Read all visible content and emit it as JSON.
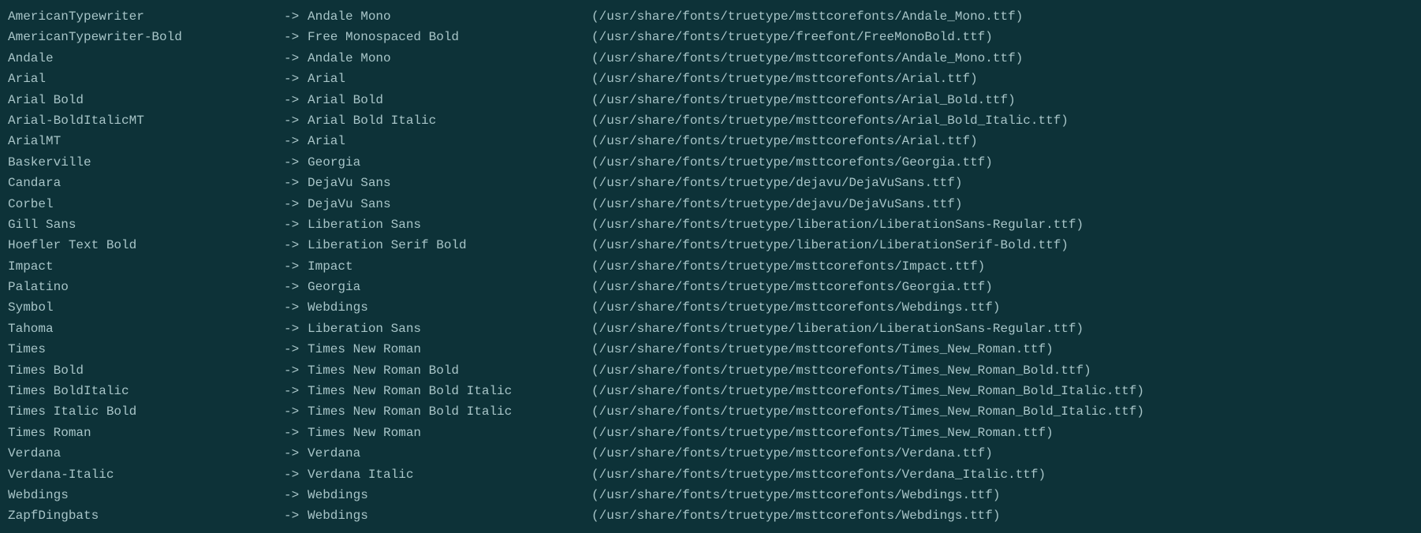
{
  "arrow": "->",
  "mappings": [
    {
      "source": "AmericanTypewriter",
      "target": "Andale Mono",
      "path": "(/usr/share/fonts/truetype/msttcorefonts/Andale_Mono.ttf)"
    },
    {
      "source": "AmericanTypewriter-Bold",
      "target": "Free Monospaced Bold",
      "path": "(/usr/share/fonts/truetype/freefont/FreeMonoBold.ttf)"
    },
    {
      "source": "Andale",
      "target": "Andale Mono",
      "path": "(/usr/share/fonts/truetype/msttcorefonts/Andale_Mono.ttf)"
    },
    {
      "source": "Arial",
      "target": "Arial",
      "path": "(/usr/share/fonts/truetype/msttcorefonts/Arial.ttf)"
    },
    {
      "source": "Arial Bold",
      "target": "Arial Bold",
      "path": "(/usr/share/fonts/truetype/msttcorefonts/Arial_Bold.ttf)"
    },
    {
      "source": "Arial-BoldItalicMT",
      "target": "Arial Bold Italic",
      "path": "(/usr/share/fonts/truetype/msttcorefonts/Arial_Bold_Italic.ttf)"
    },
    {
      "source": "ArialMT",
      "target": "Arial",
      "path": "(/usr/share/fonts/truetype/msttcorefonts/Arial.ttf)"
    },
    {
      "source": "Baskerville",
      "target": "Georgia",
      "path": "(/usr/share/fonts/truetype/msttcorefonts/Georgia.ttf)"
    },
    {
      "source": "Candara",
      "target": "DejaVu Sans",
      "path": "(/usr/share/fonts/truetype/dejavu/DejaVuSans.ttf)"
    },
    {
      "source": "Corbel",
      "target": "DejaVu Sans",
      "path": "(/usr/share/fonts/truetype/dejavu/DejaVuSans.ttf)"
    },
    {
      "source": "Gill Sans",
      "target": "Liberation Sans",
      "path": "(/usr/share/fonts/truetype/liberation/LiberationSans-Regular.ttf)"
    },
    {
      "source": "Hoefler Text Bold",
      "target": "Liberation Serif Bold",
      "path": "(/usr/share/fonts/truetype/liberation/LiberationSerif-Bold.ttf)"
    },
    {
      "source": "Impact",
      "target": "Impact",
      "path": "(/usr/share/fonts/truetype/msttcorefonts/Impact.ttf)"
    },
    {
      "source": "Palatino",
      "target": "Georgia",
      "path": "(/usr/share/fonts/truetype/msttcorefonts/Georgia.ttf)"
    },
    {
      "source": "Symbol",
      "target": "Webdings",
      "path": "(/usr/share/fonts/truetype/msttcorefonts/Webdings.ttf)"
    },
    {
      "source": "Tahoma",
      "target": "Liberation Sans",
      "path": "(/usr/share/fonts/truetype/liberation/LiberationSans-Regular.ttf)"
    },
    {
      "source": "Times",
      "target": "Times New Roman",
      "path": "(/usr/share/fonts/truetype/msttcorefonts/Times_New_Roman.ttf)"
    },
    {
      "source": "Times Bold",
      "target": "Times New Roman Bold",
      "path": "(/usr/share/fonts/truetype/msttcorefonts/Times_New_Roman_Bold.ttf)"
    },
    {
      "source": "Times BoldItalic",
      "target": "Times New Roman Bold Italic",
      "path": "(/usr/share/fonts/truetype/msttcorefonts/Times_New_Roman_Bold_Italic.ttf)"
    },
    {
      "source": "Times Italic Bold",
      "target": "Times New Roman Bold Italic",
      "path": "(/usr/share/fonts/truetype/msttcorefonts/Times_New_Roman_Bold_Italic.ttf)"
    },
    {
      "source": "Times Roman",
      "target": "Times New Roman",
      "path": "(/usr/share/fonts/truetype/msttcorefonts/Times_New_Roman.ttf)"
    },
    {
      "source": "Verdana",
      "target": "Verdana",
      "path": "(/usr/share/fonts/truetype/msttcorefonts/Verdana.ttf)"
    },
    {
      "source": "Verdana-Italic",
      "target": "Verdana Italic",
      "path": "(/usr/share/fonts/truetype/msttcorefonts/Verdana_Italic.ttf)"
    },
    {
      "source": "Webdings",
      "target": "Webdings",
      "path": "(/usr/share/fonts/truetype/msttcorefonts/Webdings.ttf)"
    },
    {
      "source": "ZapfDingbats",
      "target": "Webdings",
      "path": "(/usr/share/fonts/truetype/msttcorefonts/Webdings.ttf)"
    }
  ]
}
